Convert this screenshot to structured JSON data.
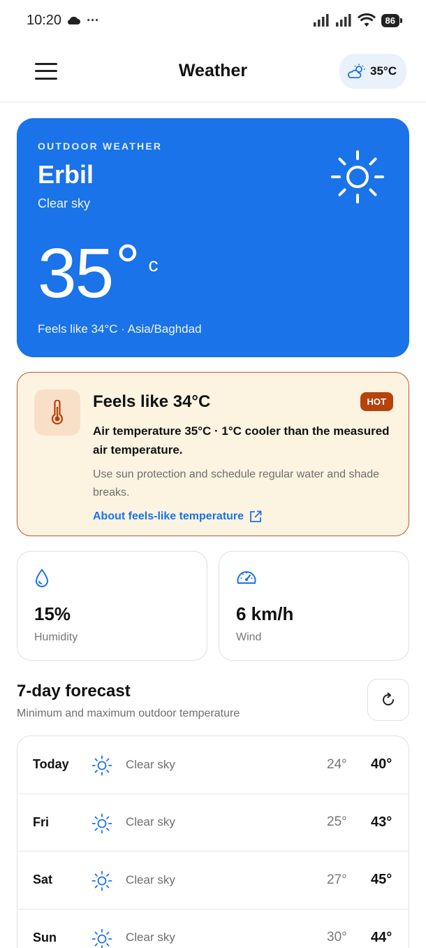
{
  "status_bar": {
    "time": "10:20",
    "dots": "···",
    "battery": "86"
  },
  "app_bar": {
    "title": "Weather",
    "temp_chip": "35°C"
  },
  "outdoor": {
    "label": "OUTDOOR WEATHER",
    "city": "Erbil",
    "condition": "Clear sky",
    "temperature": "35",
    "degree": "°",
    "unit": "c",
    "feels_line": "Feels like 34°C · Asia/Baghdad"
  },
  "feels_card": {
    "title": "Feels like 34°C",
    "badge": "HOT",
    "description": "Air temperature 35°C · 1°C cooler than the measured air temperature.",
    "advice": "Use sun protection and schedule regular water and shade breaks.",
    "link": "About feels-like temperature"
  },
  "stats": {
    "humidity": {
      "value": "15%",
      "label": "Humidity"
    },
    "wind": {
      "value": "6 km/h",
      "label": "Wind"
    }
  },
  "forecast": {
    "title": "7-day forecast",
    "subtitle": "Minimum and maximum outdoor temperature",
    "days": [
      {
        "day": "Today",
        "condition": "Clear sky",
        "min": "24°",
        "max": "40°"
      },
      {
        "day": "Fri",
        "condition": "Clear sky",
        "min": "25°",
        "max": "43°"
      },
      {
        "day": "Sat",
        "condition": "Clear sky",
        "min": "27°",
        "max": "45°"
      },
      {
        "day": "Sun",
        "condition": "Clear sky",
        "min": "30°",
        "max": "44°"
      }
    ]
  },
  "colors": {
    "accent": "#1a73e8",
    "hot_badge": "#b5430c",
    "warning_bg": "#fdf3e1"
  }
}
